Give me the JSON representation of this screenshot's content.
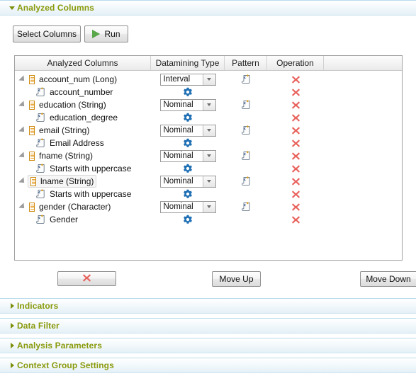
{
  "panel": {
    "title": "Analyzed Columns",
    "expanded_icon": "triangle-down-icon"
  },
  "toolbar": {
    "select_columns_label": "Select Columns",
    "run_label": "Run",
    "run_icon": "play-icon"
  },
  "table": {
    "headers": [
      "Analyzed Columns",
      "Datamining Type",
      "Pattern",
      "Operation",
      ""
    ],
    "rows": [
      {
        "kind": "column",
        "expander": "expander-icon",
        "icon": "column-icon",
        "label": "account_num (Long)",
        "datamining_type": "Interval",
        "pattern_icon": "pattern-scroll-icon",
        "operation_icon": "delete-x-icon",
        "selected": false
      },
      {
        "kind": "indicator",
        "icon": "indicator-scroll-icon",
        "label": "account_number",
        "gear_icon": "gear-icon",
        "operation_icon": "delete-x-icon"
      },
      {
        "kind": "column",
        "expander": "expander-icon",
        "icon": "column-icon",
        "label": "education (String)",
        "datamining_type": "Nominal",
        "pattern_icon": "pattern-scroll-icon",
        "operation_icon": "delete-x-icon",
        "selected": false
      },
      {
        "kind": "indicator",
        "icon": "indicator-scroll-icon",
        "label": "education_degree",
        "gear_icon": "gear-icon",
        "operation_icon": "delete-x-icon"
      },
      {
        "kind": "column",
        "expander": "expander-icon",
        "icon": "column-icon",
        "label": "email (String)",
        "datamining_type": "Nominal",
        "pattern_icon": "pattern-scroll-icon",
        "operation_icon": "delete-x-icon",
        "selected": false
      },
      {
        "kind": "indicator",
        "icon": "indicator-scroll-icon",
        "label": "Email Address",
        "gear_icon": "gear-icon",
        "operation_icon": "delete-x-icon"
      },
      {
        "kind": "column",
        "expander": "expander-icon",
        "icon": "column-icon",
        "label": "fname (String)",
        "datamining_type": "Nominal",
        "pattern_icon": "pattern-scroll-icon",
        "operation_icon": "delete-x-icon",
        "selected": false
      },
      {
        "kind": "indicator",
        "icon": "indicator-scroll-icon",
        "label": "Starts with uppercase",
        "gear_icon": "gear-icon",
        "operation_icon": "delete-x-icon"
      },
      {
        "kind": "column",
        "expander": "expander-icon",
        "icon": "column-icon",
        "label": "lname (String)",
        "datamining_type": "Nominal",
        "pattern_icon": "pattern-scroll-icon",
        "operation_icon": "delete-x-icon",
        "selected": true
      },
      {
        "kind": "indicator",
        "icon": "indicator-scroll-icon",
        "label": "Starts with uppercase",
        "gear_icon": "gear-icon",
        "operation_icon": "delete-x-icon"
      },
      {
        "kind": "column",
        "expander": "expander-icon",
        "icon": "column-icon",
        "label": "gender (Character)",
        "datamining_type": "Nominal",
        "pattern_icon": "pattern-scroll-icon",
        "operation_icon": "delete-x-icon",
        "selected": false
      },
      {
        "kind": "indicator",
        "icon": "indicator-scroll-icon",
        "label": "Gender",
        "gear_icon": "gear-icon",
        "operation_icon": "delete-x-icon"
      }
    ]
  },
  "footer": {
    "delete_icon": "delete-x-icon",
    "move_up_label": "Move Up",
    "move_down_label": "Move Down"
  },
  "sections": [
    {
      "label": "Indicators",
      "collapsed_icon": "triangle-right-icon"
    },
    {
      "label": "Data Filter",
      "collapsed_icon": "triangle-right-icon"
    },
    {
      "label": "Analysis Parameters",
      "collapsed_icon": "triangle-right-icon"
    },
    {
      "label": "Context Group Settings",
      "collapsed_icon": "triangle-right-icon"
    }
  ],
  "colors": {
    "section_title": "#8a9a0b",
    "section_bar_border": "#b9dced",
    "gear": "#1f6fb4",
    "delete_x": "#e8605a",
    "column_icon": "#cf8b12",
    "run_arrow": "#5aa74a"
  }
}
